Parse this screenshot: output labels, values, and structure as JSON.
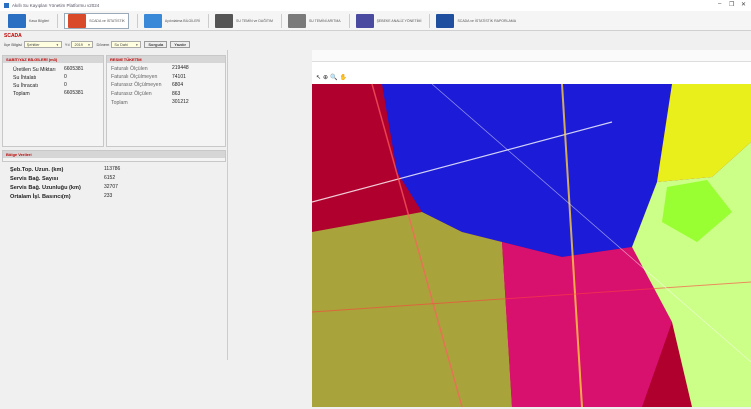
{
  "window": {
    "title": "Akıllı Su Kayıpları Yönetim Platformu v2024",
    "controls": [
      "–",
      "❐",
      "✕"
    ]
  },
  "toolbar": {
    "items": [
      {
        "label": "Kasa Bilgileri",
        "color": "#2a6fc2",
        "active": false
      },
      {
        "label": "SCADA ve İSTATİSTİK",
        "color": "#d84a2a",
        "active": true
      },
      {
        "label": "Aydınlatma BİLGİLERİ",
        "color": "#3a88d8",
        "active": false
      },
      {
        "label": "SU TEMİN ve DAĞITIM",
        "color": "#555555",
        "active": false
      },
      {
        "label": "SU TEMİNİ ARITMA",
        "color": "#7a7a7a",
        "active": false
      },
      {
        "label": "ŞEBEKE ANALİZ YÖNETİMİ",
        "color": "#4a4aa0",
        "active": false
      },
      {
        "label": "SCADA ve İSTATİSTİK RAPORLAMA",
        "color": "#1f4f9e",
        "active": false
      }
    ]
  },
  "scada": {
    "title": "SCADA",
    "filters": {
      "ilce_label": "İlçe Bilgisi",
      "ilce_value": "Şehitler",
      "yil_label": "Yıl",
      "yil_value": "2019",
      "donem_label": "Dönem",
      "donem_value": "Su Dahi",
      "sorgula": "Sorgula",
      "yazdir": "Yazdır"
    }
  },
  "su_bilgileri": {
    "header": "SABİT/YAZ BİLGİLERİ (m3)",
    "rows": [
      {
        "key": "Üretilen Su Miktarı",
        "value": "6605381"
      },
      {
        "key": "Su İhtalatı",
        "value": "0"
      },
      {
        "key": "Su İhracatı",
        "value": "0"
      },
      {
        "key": "Toplam",
        "value": "6605381"
      }
    ]
  },
  "resmi_tuketim": {
    "header": "RESMİ TÜKETİM",
    "rows": [
      {
        "key": "Faturalı Ölçülen",
        "value": "219448"
      },
      {
        "key": "Faturalı Ölçülmeyen",
        "value": "74101"
      },
      {
        "key": "Faturasız Ölçülmeyen",
        "value": "6804"
      },
      {
        "key": "Faturasız Ölçülen",
        "value": "863"
      },
      {
        "key": "Toplam",
        "value": "301212"
      }
    ]
  },
  "bolge": {
    "header": "Bölge Verileri",
    "rows": [
      {
        "key": "Şeb.Top. Uzun. (km)",
        "value": "113786"
      },
      {
        "key": "Servis Bağ. Sayısı",
        "value": "6152"
      },
      {
        "key": "Servis Bağ. Uzunluğu (km)",
        "value": "32707"
      },
      {
        "key": "Ortalam İşl. Basıncı(m)",
        "value": "233"
      }
    ]
  },
  "map": {
    "tools": [
      "↖",
      "⊕",
      "🔍",
      "✋"
    ]
  }
}
